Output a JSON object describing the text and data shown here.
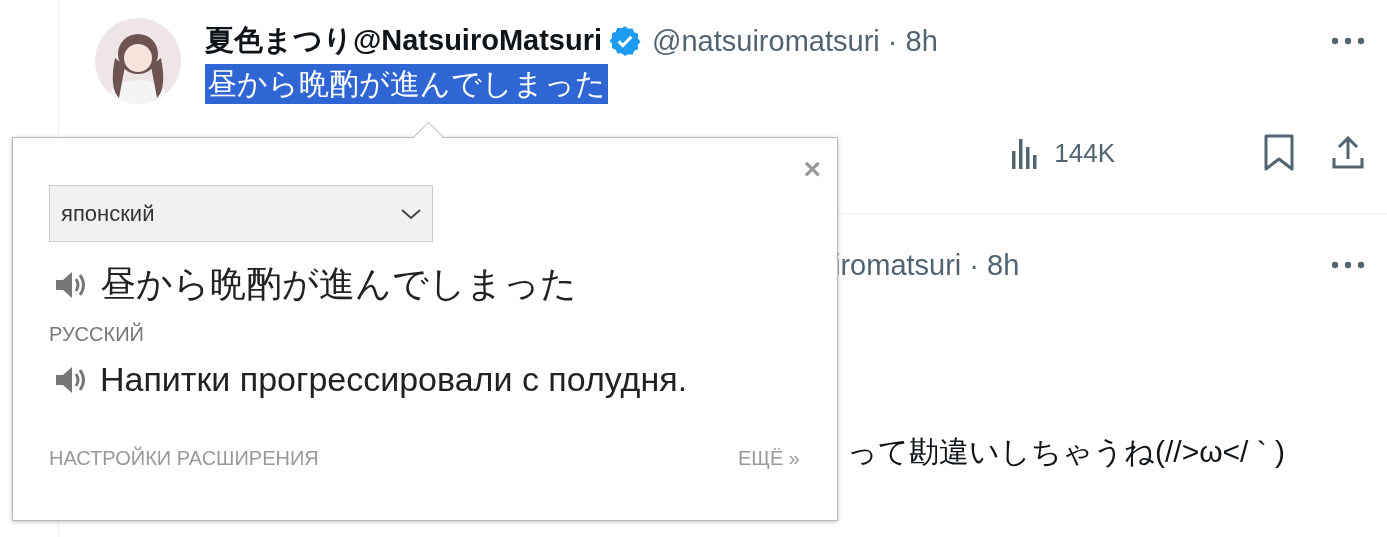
{
  "tweets": [
    {
      "author": "夏色まつり@NatsuiroMatsuri",
      "verified": true,
      "meta": "@natsuiromatsuri · 8h",
      "text": "昼から晩酌が進んでしまった",
      "text_selected": true,
      "views": "144K"
    },
    {
      "meta": "iromatsuri · 8h",
      "text": "って勘違いしちゃうね(//>ω</ ` )"
    }
  ],
  "translate_popup": {
    "close": "×",
    "source_language": "японский",
    "source_text": "昼から晩酌が進んでしまった",
    "target_language": "РУССКИЙ",
    "translation": "Напитки прогрессировали с полудня.",
    "settings_link": "НАСТРОЙКИ РАСШИРЕНИЯ",
    "more_link": "ЕЩЁ »"
  }
}
